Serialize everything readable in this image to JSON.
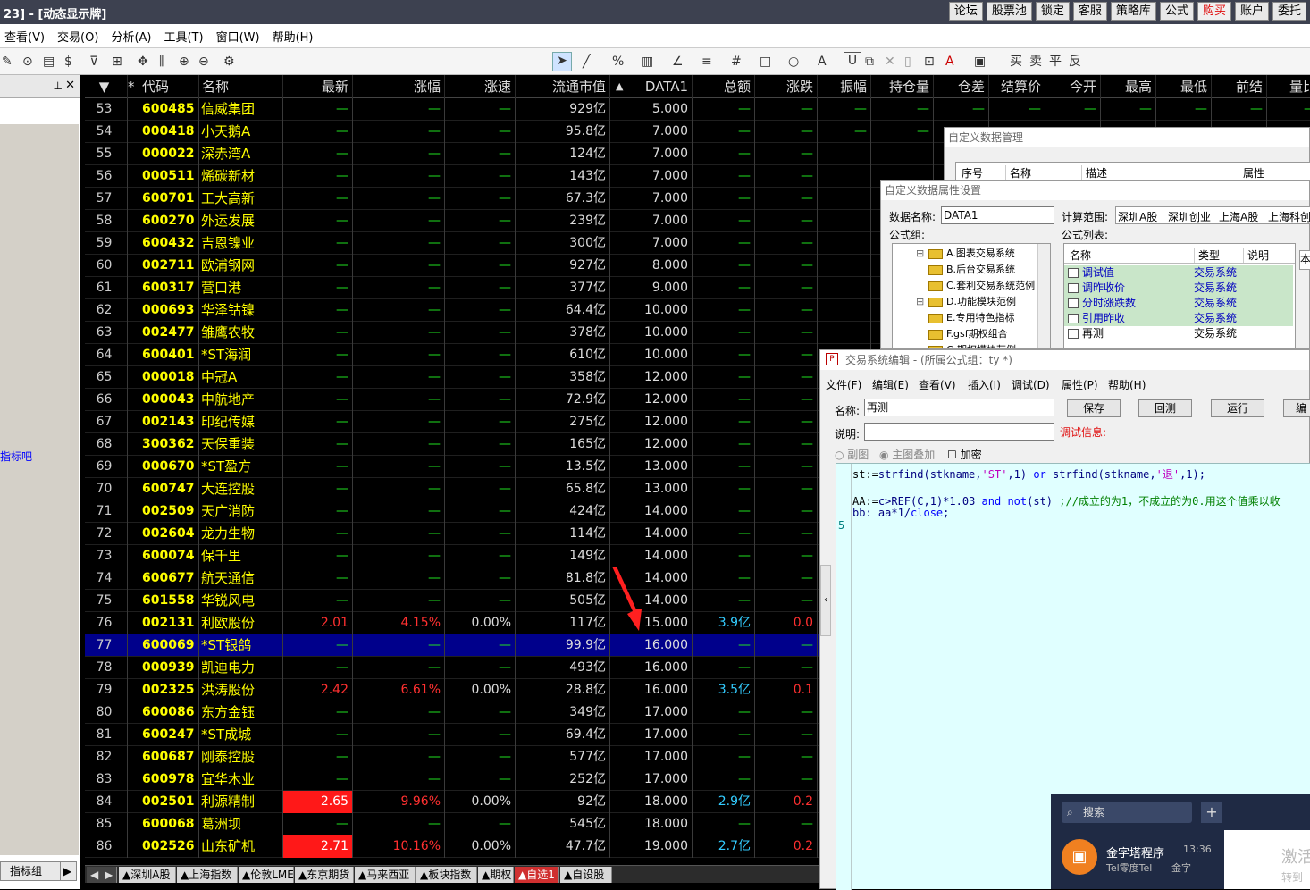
{
  "titlebar": {
    "title": "23] - [动态显示牌]",
    "buttons": [
      "论坛",
      "股票池",
      "锁定",
      "客服",
      "策略库",
      "公式",
      "购买",
      "账户",
      "委托"
    ]
  },
  "menubar": [
    "查看(V)",
    "交易(O)",
    "分析(A)",
    "工具(T)",
    "窗口(W)",
    "帮助(H)"
  ],
  "toolbar": {
    "trade_buttons": [
      "买",
      "卖",
      "平",
      "反"
    ]
  },
  "leftpanel": {
    "link": "指标吧",
    "bottom_tab": "指标组"
  },
  "grid": {
    "headers": [
      "代码",
      "名称",
      "最新",
      "涨幅",
      "涨速",
      "流通市值",
      "DATA1",
      "总额",
      "涨跌",
      "振幅",
      "持仓量",
      "仓差",
      "结算价",
      "今开",
      "最高",
      "最低",
      "前结",
      "量比"
    ],
    "rows": [
      {
        "i": "53",
        "code": "600485",
        "name": "信威集团",
        "p": "—",
        "r": "—",
        "s": "—",
        "cap": "929亿",
        "d": "5.000",
        "amt": "—",
        "ch": "—",
        "zf": "—",
        "ccl": "—",
        "cc": "—",
        "js": "—",
        "jk": "—",
        "zg": "—",
        "zd": "—",
        "qj": "—",
        "lb": "—"
      },
      {
        "i": "54",
        "code": "000418",
        "name": "小天鹅A",
        "p": "—",
        "r": "—",
        "s": "—",
        "cap": "95.8亿",
        "d": "7.000",
        "amt": "—",
        "ch": "—",
        "zf": "—",
        "ccl": "—"
      },
      {
        "i": "55",
        "code": "000022",
        "name": "深赤湾A",
        "p": "—",
        "r": "—",
        "s": "—",
        "cap": "124亿",
        "d": "7.000",
        "amt": "—",
        "ch": "—"
      },
      {
        "i": "56",
        "code": "000511",
        "name": "烯碳新材",
        "p": "—",
        "r": "—",
        "s": "—",
        "cap": "143亿",
        "d": "7.000",
        "amt": "—",
        "ch": "—"
      },
      {
        "i": "57",
        "code": "600701",
        "name": "工大高新",
        "p": "—",
        "r": "—",
        "s": "—",
        "cap": "67.3亿",
        "d": "7.000",
        "amt": "—",
        "ch": "—"
      },
      {
        "i": "58",
        "code": "600270",
        "name": "外运发展",
        "p": "—",
        "r": "—",
        "s": "—",
        "cap": "239亿",
        "d": "7.000",
        "amt": "—",
        "ch": "—"
      },
      {
        "i": "59",
        "code": "600432",
        "name": "吉恩镍业",
        "p": "—",
        "r": "—",
        "s": "—",
        "cap": "300亿",
        "d": "7.000",
        "amt": "—",
        "ch": "—"
      },
      {
        "i": "60",
        "code": "002711",
        "name": "欧浦钢网",
        "p": "—",
        "r": "—",
        "s": "—",
        "cap": "927亿",
        "d": "8.000",
        "amt": "—",
        "ch": "—"
      },
      {
        "i": "61",
        "code": "600317",
        "name": "营口港",
        "p": "—",
        "r": "—",
        "s": "—",
        "cap": "377亿",
        "d": "9.000",
        "amt": "—",
        "ch": "—"
      },
      {
        "i": "62",
        "code": "000693",
        "name": "华泽钴镍",
        "p": "—",
        "r": "—",
        "s": "—",
        "cap": "64.4亿",
        "d": "10.000",
        "amt": "—",
        "ch": "—"
      },
      {
        "i": "63",
        "code": "002477",
        "name": "雏鹰农牧",
        "p": "—",
        "r": "—",
        "s": "—",
        "cap": "378亿",
        "d": "10.000",
        "amt": "—",
        "ch": "—"
      },
      {
        "i": "64",
        "code": "600401",
        "name": "*ST海润",
        "p": "—",
        "r": "—",
        "s": "—",
        "cap": "610亿",
        "d": "10.000",
        "amt": "—",
        "ch": "—"
      },
      {
        "i": "65",
        "code": "000018",
        "name": "中冠A",
        "p": "—",
        "r": "—",
        "s": "—",
        "cap": "358亿",
        "d": "12.000",
        "amt": "—",
        "ch": "—"
      },
      {
        "i": "66",
        "code": "000043",
        "name": "中航地产",
        "p": "—",
        "r": "—",
        "s": "—",
        "cap": "72.9亿",
        "d": "12.000",
        "amt": "—",
        "ch": "—"
      },
      {
        "i": "67",
        "code": "002143",
        "name": "印纪传媒",
        "p": "—",
        "r": "—",
        "s": "—",
        "cap": "275亿",
        "d": "12.000",
        "amt": "—",
        "ch": "—"
      },
      {
        "i": "68",
        "code": "300362",
        "name": "天保重装",
        "p": "—",
        "r": "—",
        "s": "—",
        "cap": "165亿",
        "d": "12.000",
        "amt": "—",
        "ch": "—"
      },
      {
        "i": "69",
        "code": "000670",
        "name": "*ST盈方",
        "p": "—",
        "r": "—",
        "s": "—",
        "cap": "13.5亿",
        "d": "13.000",
        "amt": "—",
        "ch": "—"
      },
      {
        "i": "70",
        "code": "600747",
        "name": "大连控股",
        "p": "—",
        "r": "—",
        "s": "—",
        "cap": "65.8亿",
        "d": "13.000",
        "amt": "—",
        "ch": "—"
      },
      {
        "i": "71",
        "code": "002509",
        "name": "天广消防",
        "p": "—",
        "r": "—",
        "s": "—",
        "cap": "424亿",
        "d": "14.000",
        "amt": "—",
        "ch": "—"
      },
      {
        "i": "72",
        "code": "002604",
        "name": "龙力生物",
        "p": "—",
        "r": "—",
        "s": "—",
        "cap": "114亿",
        "d": "14.000",
        "amt": "—",
        "ch": "—"
      },
      {
        "i": "73",
        "code": "600074",
        "name": "保千里",
        "p": "—",
        "r": "—",
        "s": "—",
        "cap": "149亿",
        "d": "14.000",
        "amt": "—",
        "ch": "—"
      },
      {
        "i": "74",
        "code": "600677",
        "name": "航天通信",
        "p": "—",
        "r": "—",
        "s": "—",
        "cap": "81.8亿",
        "d": "14.000",
        "amt": "—",
        "ch": "—"
      },
      {
        "i": "75",
        "code": "601558",
        "name": "华锐风电",
        "p": "—",
        "r": "—",
        "s": "—",
        "cap": "505亿",
        "d": "14.000",
        "amt": "—",
        "ch": "—"
      },
      {
        "i": "76",
        "code": "002131",
        "name": "利欧股份",
        "p": "2.01",
        "r": "4.15%",
        "s": "0.00%",
        "cap": "117亿",
        "d": "15.000",
        "amt": "3.9亿",
        "ch": "0.0",
        "t": "up"
      },
      {
        "i": "77",
        "code": "600069",
        "name": "*ST银鸽",
        "p": "—",
        "r": "—",
        "s": "—",
        "cap": "99.9亿",
        "d": "16.000",
        "amt": "—",
        "ch": "—",
        "sel": true
      },
      {
        "i": "78",
        "code": "000939",
        "name": "凯迪电力",
        "p": "—",
        "r": "—",
        "s": "—",
        "cap": "493亿",
        "d": "16.000",
        "amt": "—",
        "ch": "—"
      },
      {
        "i": "79",
        "code": "002325",
        "name": "洪涛股份",
        "p": "2.42",
        "r": "6.61%",
        "s": "0.00%",
        "cap": "28.8亿",
        "d": "16.000",
        "amt": "3.5亿",
        "ch": "0.1",
        "t": "up"
      },
      {
        "i": "80",
        "code": "600086",
        "name": "东方金钰",
        "p": "—",
        "r": "—",
        "s": "—",
        "cap": "349亿",
        "d": "17.000",
        "amt": "—",
        "ch": "—"
      },
      {
        "i": "81",
        "code": "600247",
        "name": "*ST成城",
        "p": "—",
        "r": "—",
        "s": "—",
        "cap": "69.4亿",
        "d": "17.000",
        "amt": "—",
        "ch": "—"
      },
      {
        "i": "82",
        "code": "600687",
        "name": "刚泰控股",
        "p": "—",
        "r": "—",
        "s": "—",
        "cap": "577亿",
        "d": "17.000",
        "amt": "—",
        "ch": "—"
      },
      {
        "i": "83",
        "code": "600978",
        "name": "宜华木业",
        "p": "—",
        "r": "—",
        "s": "—",
        "cap": "252亿",
        "d": "17.000",
        "amt": "—",
        "ch": "—"
      },
      {
        "i": "84",
        "code": "002501",
        "name": "利源精制",
        "p": "2.65",
        "r": "9.96%",
        "s": "0.00%",
        "cap": "92亿",
        "d": "18.000",
        "amt": "2.9亿",
        "ch": "0.2",
        "t": "lim"
      },
      {
        "i": "85",
        "code": "600068",
        "name": "葛洲坝",
        "p": "—",
        "r": "—",
        "s": "—",
        "cap": "545亿",
        "d": "18.000",
        "amt": "—",
        "ch": "—"
      },
      {
        "i": "86",
        "code": "002526",
        "name": "山东矿机",
        "p": "2.71",
        "r": "10.16%",
        "s": "0.00%",
        "cap": "47.7亿",
        "d": "19.000",
        "amt": "2.7亿",
        "ch": "0.2",
        "t": "lim"
      }
    ]
  },
  "tabs": [
    "▲深圳A股",
    "▲上海指数",
    "▲伦敦LME",
    "▲东京期货",
    "▲马来西亚",
    "▲板块指数",
    "▲期权",
    "▲自选1",
    "▲自设股"
  ],
  "win_mgr": {
    "title": "自定义数据管理",
    "cols": [
      "序号",
      "名称",
      "描述",
      "属性"
    ]
  },
  "win_prop": {
    "title": "自定义数据属性设置",
    "data_name_label": "数据名称:",
    "data_name": "DATA1",
    "range_label": "计算范围:",
    "ranges": [
      "深圳A股",
      "深圳创业",
      "上海A股",
      "上海科创"
    ],
    "group_label": "公式组:",
    "tree": [
      "A.图表交易系统",
      "B.后台交易系统",
      "C.套利交易系统范例",
      "D.功能模块范例",
      "E.专用特色指标",
      "F.gsf期权组合",
      "G.期权模块范例"
    ],
    "list_label": "公式列表:",
    "list_cols": [
      "名称",
      "类型",
      "说明"
    ],
    "list": [
      {
        "n": "调试值",
        "t": "交易系统"
      },
      {
        "n": "调昨收价",
        "t": "交易系统"
      },
      {
        "n": "分时涨跌数",
        "t": "交易系统"
      },
      {
        "n": "引用昨收",
        "t": "交易系统"
      },
      {
        "n": "再测",
        "t": "交易系统"
      }
    ],
    "side_char": "本"
  },
  "win_edit": {
    "title": "交易系统编辑 - (所属公式组：ty *)",
    "menu": [
      "文件(F)",
      "编辑(E)",
      "查看(V)",
      "插入(I)",
      "调试(D)",
      "属性(P)",
      "帮助(H)"
    ],
    "name_label": "名称:",
    "name": "再测",
    "desc_label": "说明:",
    "desc": "",
    "buttons": [
      "保存",
      "回测",
      "运行",
      "编"
    ],
    "debug": "调试信息:",
    "opts": [
      "副图",
      "主图叠加",
      "加密"
    ],
    "code": {
      "l1a": "st:=",
      "l1b": "strfind",
      "l1c": "(stkname,",
      "l1d": "'ST'",
      "l1e": ",1) ",
      "l1f": "or",
      "l1g": " strfind",
      "l1h": "(stkname,",
      "l1i": "'退'",
      "l1j": ",1);",
      "l2a": "AA:=",
      "l2b": "c>",
      "l2c": "REF",
      "l2d": "(C,1)*1.03  ",
      "l2e": "and",
      "l2f": "  not",
      "l2g": "(st) ",
      "l2h": ";//成立的为1，不成立的为0.用这个值乘以收",
      "l3a": "bb:  aa*1/",
      "l3b": "close",
      ";": ";"
    },
    "gutter": "5"
  },
  "notif": {
    "search": "搜索",
    "plus": "+",
    "app": "金字塔程序",
    "time": "13:36",
    "sub1": "Tel零度Tel",
    "sub2": "金字",
    "activate": "激活",
    "activate2": "转到"
  }
}
